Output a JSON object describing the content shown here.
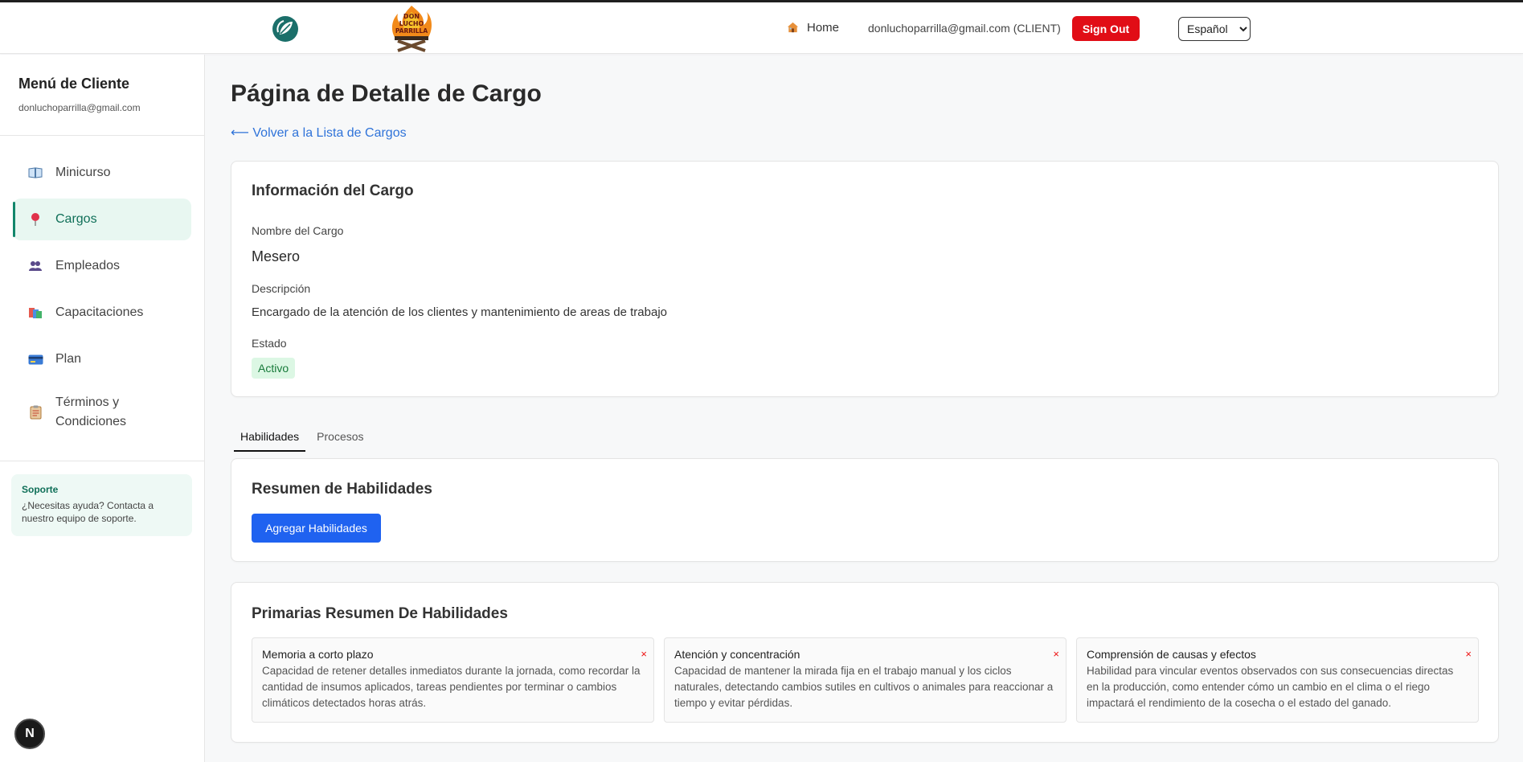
{
  "header": {
    "home_label": "Home",
    "user_label": "donluchoparrilla@gmail.com (CLIENT)",
    "signout_label": "Sign Out",
    "language_options": [
      "Español"
    ],
    "language_selected": "Español",
    "brand_logo_lines": [
      "DON",
      "LUCHO",
      "PARRILLA"
    ]
  },
  "sidebar": {
    "title": "Menú de Cliente",
    "email": "donluchoparrilla@gmail.com",
    "items": [
      {
        "label": "Minicurso",
        "icon": "book-icon"
      },
      {
        "label": "Cargos",
        "icon": "pin-icon"
      },
      {
        "label": "Empleados",
        "icon": "people-icon"
      },
      {
        "label": "Capacitaciones",
        "icon": "books-icon"
      },
      {
        "label": "Plan",
        "icon": "credit-card-icon"
      },
      {
        "label": "Términos y Condiciones",
        "icon": "clipboard-icon"
      }
    ],
    "support": {
      "title": "Soporte",
      "text": "¿Necesitas ayuda? Contacta a nuestro equipo de soporte."
    }
  },
  "main": {
    "title": "Página de Detalle de Cargo",
    "back_link": "⟵ Volver a la Lista de Cargos",
    "info": {
      "heading": "Información del Cargo",
      "name_label": "Nombre del Cargo",
      "name_value": "Mesero",
      "desc_label": "Descripción",
      "desc_value": "Encargado de la atención de los clientes y mantenimiento de areas de trabajo",
      "status_label": "Estado",
      "status_value": "Activo"
    },
    "tabs": [
      {
        "label": "Habilidades",
        "active": true
      },
      {
        "label": "Procesos",
        "active": false
      }
    ],
    "summary": {
      "heading": "Resumen de Habilidades",
      "add_button": "Agregar Habilidades"
    },
    "primary": {
      "heading": "Primarias Resumen De Habilidades",
      "skills": [
        {
          "title": "Memoria a corto plazo",
          "description": "Capacidad de retener detalles inmediatos durante la jornada, como recordar la cantidad de insumos aplicados, tareas pendientes por terminar o cambios climáticos detectados horas atrás.",
          "remove": "×"
        },
        {
          "title": "Atención y concentración",
          "description": "Capacidad de mantener la mirada fija en el trabajo manual y los ciclos naturales, detectando cambios sutiles en cultivos o animales para reaccionar a tiempo y evitar pérdidas.",
          "remove": "×"
        },
        {
          "title": "Comprensión de causas y efectos",
          "description": "Habilidad para vincular eventos observados con sus consecuencias directas en la producción, como entender cómo un cambio en el clima o el riego impactará el rendimiento de la cosecha o el estado del ganado.",
          "remove": "×"
        }
      ]
    }
  },
  "dev_badge": "N",
  "colors": {
    "accent": "#12866b",
    "danger": "#e10d16",
    "primary_button": "#1f62f0",
    "link": "#2f73d9"
  }
}
